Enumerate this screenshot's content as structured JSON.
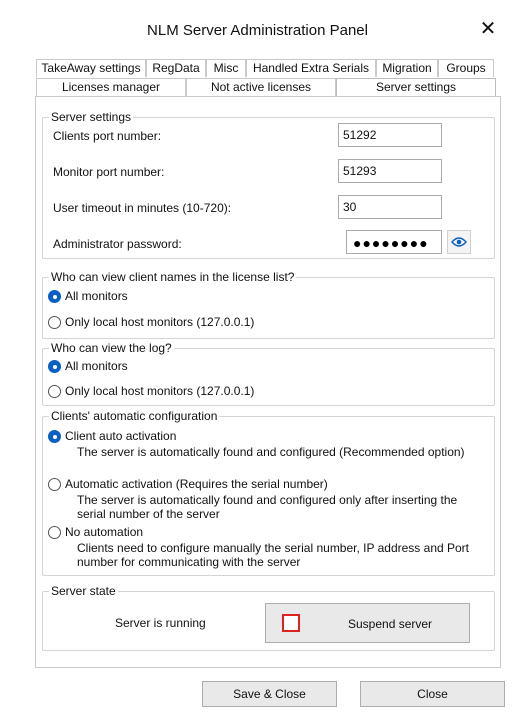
{
  "window": {
    "title": "NLM Server Administration Panel",
    "close_glyph": "✕"
  },
  "tabs_row1": [
    "TakeAway settings",
    "RegData",
    "Misc",
    "Handled Extra Serials",
    "Migration",
    "Groups"
  ],
  "tabs_row2": [
    "Licenses manager",
    "Not active licenses",
    "Server settings"
  ],
  "active_tab": "Server settings",
  "server_settings": {
    "legend": "Server settings",
    "clients_port_label": "Clients port number:",
    "clients_port_value": "51292",
    "monitor_port_label": "Monitor port number:",
    "monitor_port_value": "51293",
    "timeout_label": "User timeout in minutes (10-720):",
    "timeout_value": "30",
    "password_label": "Administrator password:",
    "password_mask": "●●●●●●●●",
    "show_password_icon": "eye-icon"
  },
  "client_names": {
    "legend": "Who can view client names in the license list?",
    "options": [
      "All monitors",
      "Only local host monitors (127.0.0.1)"
    ],
    "selected": 0
  },
  "log_view": {
    "legend": "Who can view the log?",
    "options": [
      "All monitors",
      "Only local host monitors (127.0.0.1)"
    ],
    "selected": 0
  },
  "auto_config": {
    "legend": "Clients' automatic configuration",
    "selected": 0,
    "options": [
      {
        "label": "Client auto activation",
        "desc": "The server is automatically found and configured (Recommended option)"
      },
      {
        "label": "Automatic activation (Requires the serial number)",
        "desc": "The server is automatically found and configured only after inserting the serial number of the server"
      },
      {
        "label": "No automation",
        "desc": "Clients need to configure manually the serial number, IP address and Port number for communicating with the server"
      }
    ]
  },
  "server_state": {
    "legend": "Server state",
    "status": "Server is running",
    "suspend_label": "Suspend server"
  },
  "footer": {
    "save_close": "Save & Close",
    "close": "Close"
  },
  "colors": {
    "accent": "#0a5fc5",
    "suspend_red": "#dd2222"
  }
}
